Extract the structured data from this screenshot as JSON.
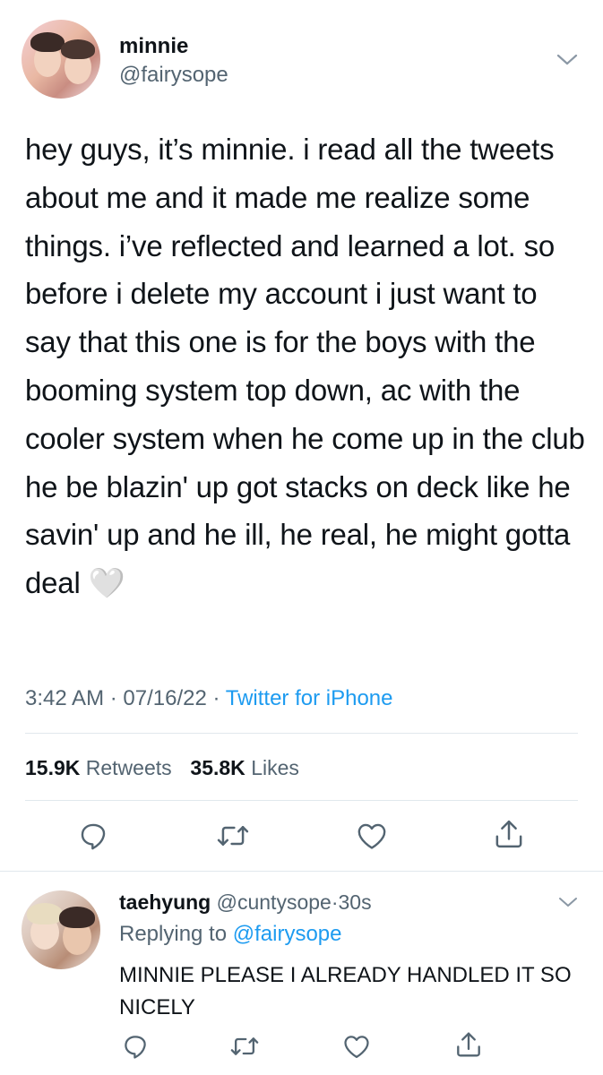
{
  "tweet": {
    "author_name": "minnie",
    "author_handle": "@fairysope",
    "text": "hey guys, it’s minnie. i read all the tweets about me and it made me realize some things. i’ve reflected and learned a lot. so before i delete my account i just want to say that this one is for the boys with the booming system top down, ac with the cooler system when he come up in the club he be blazin' up got stacks on deck like he savin' up and he ill, he real, he might gotta deal 🤍",
    "time": "3:42 AM",
    "date": "07/16/22",
    "source": "Twitter for iPhone",
    "retweets_count": "15.9K",
    "retweets_label": "Retweets",
    "likes_count": "35.8K",
    "likes_label": "Likes"
  },
  "reply": {
    "author_name": "taehyung",
    "author_handle": "@cuntysope",
    "time_ago": "30s",
    "replying_prefix": "Replying to",
    "replying_to": "@fairysope",
    "text": "MINNIE PLEASE I ALREADY HANDLED IT SO NICELY"
  },
  "icons": [
    "chevron-down-icon",
    "reply-icon",
    "retweet-icon",
    "like-icon",
    "share-icon"
  ],
  "colors": {
    "link": "#1d9bf0",
    "secondary_text": "#536471",
    "divider": "#e1e8ed"
  }
}
